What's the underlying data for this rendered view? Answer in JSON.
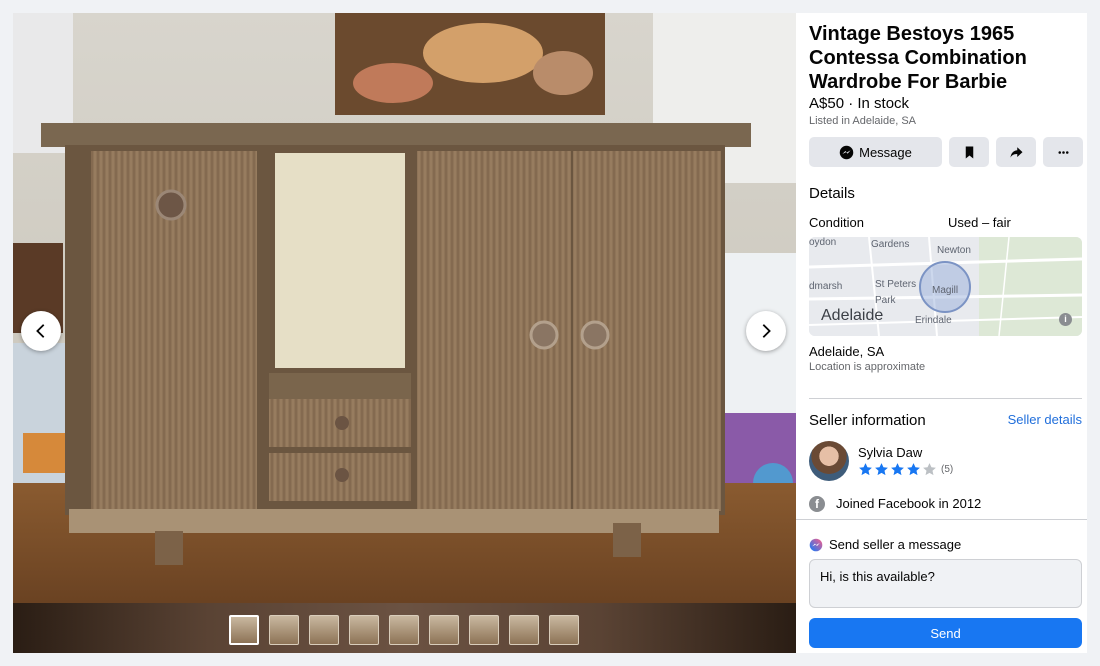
{
  "listing": {
    "title": "Vintage Bestoys 1965 Contessa Combination Wardrobe For Barbie",
    "price_status": "A$50 · In stock",
    "listed_in": "Listed in Adelaide, SA"
  },
  "actions": {
    "message_label": "Message",
    "icons": [
      "messenger-icon",
      "bookmark-icon",
      "share-icon",
      "more-icon"
    ]
  },
  "details": {
    "heading": "Details",
    "condition_label": "Condition",
    "condition_value": "Used – fair"
  },
  "map": {
    "city_label": "Adelaide",
    "places": [
      "oydon",
      "Gardens",
      "Newton",
      "dmarsh",
      "St Peters",
      "Magill",
      "Park",
      "Erindale"
    ]
  },
  "location": {
    "name": "Adelaide, SA",
    "note": "Location is approximate"
  },
  "seller": {
    "heading": "Seller information",
    "details_link": "Seller details",
    "name": "Sylvia Daw",
    "rating": 4,
    "rating_max": 5,
    "rating_count": "(5)",
    "joined": "Joined Facebook in 2012"
  },
  "message": {
    "label": "Send seller a message",
    "input_value": "Hi, is this available?",
    "send_label": "Send"
  },
  "gallery": {
    "photo_count": 9,
    "active_index": 0
  },
  "colors": {
    "accent": "#1877f2",
    "link": "#216fdb",
    "star": "#1877f2",
    "star_empty": "#bcc0c4"
  }
}
